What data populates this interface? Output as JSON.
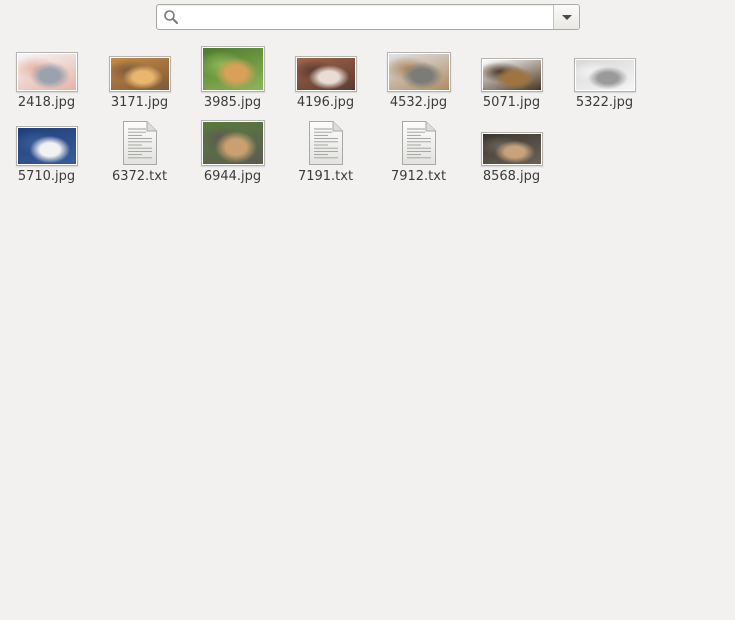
{
  "search": {
    "value": "",
    "placeholder": "",
    "icon": "search-icon",
    "dropdown_icon": "chevron-down-icon"
  },
  "files": [
    {
      "name": "2418.jpg",
      "type": "image",
      "colors": [
        "#f4f6f8",
        "#9aa3ad",
        "#e9b3a5"
      ]
    },
    {
      "name": "3171.jpg",
      "type": "image",
      "colors": [
        "#c88a45",
        "#e8b66e",
        "#7a5a3a"
      ]
    },
    {
      "name": "3985.jpg",
      "type": "image",
      "colors": [
        "#4b7a2b",
        "#d9a05a",
        "#8fb558"
      ]
    },
    {
      "name": "4196.jpg",
      "type": "image",
      "colors": [
        "#a0664a",
        "#e8dcd4",
        "#5a3a30"
      ]
    },
    {
      "name": "4532.jpg",
      "type": "image",
      "colors": [
        "#dfe3e6",
        "#7b7b78",
        "#b08a62"
      ]
    },
    {
      "name": "5071.jpg",
      "type": "image",
      "colors": [
        "#ffffff",
        "#a07440",
        "#4a3520"
      ]
    },
    {
      "name": "5322.jpg",
      "type": "image",
      "colors": [
        "#d8d8d8",
        "#9a9a9a",
        "#f5f5f5"
      ]
    },
    {
      "name": "5710.jpg",
      "type": "image",
      "colors": [
        "#1f3f7a",
        "#f2f2f2",
        "#3a5c99"
      ]
    },
    {
      "name": "6372.txt",
      "type": "text"
    },
    {
      "name": "6944.jpg",
      "type": "image",
      "colors": [
        "#567d3a",
        "#c9a070",
        "#5e5a52"
      ]
    },
    {
      "name": "7191.txt",
      "type": "text"
    },
    {
      "name": "7912.txt",
      "type": "text"
    },
    {
      "name": "8568.jpg",
      "type": "image",
      "colors": [
        "#3a3530",
        "#c7a27a",
        "#6a6358"
      ]
    }
  ]
}
